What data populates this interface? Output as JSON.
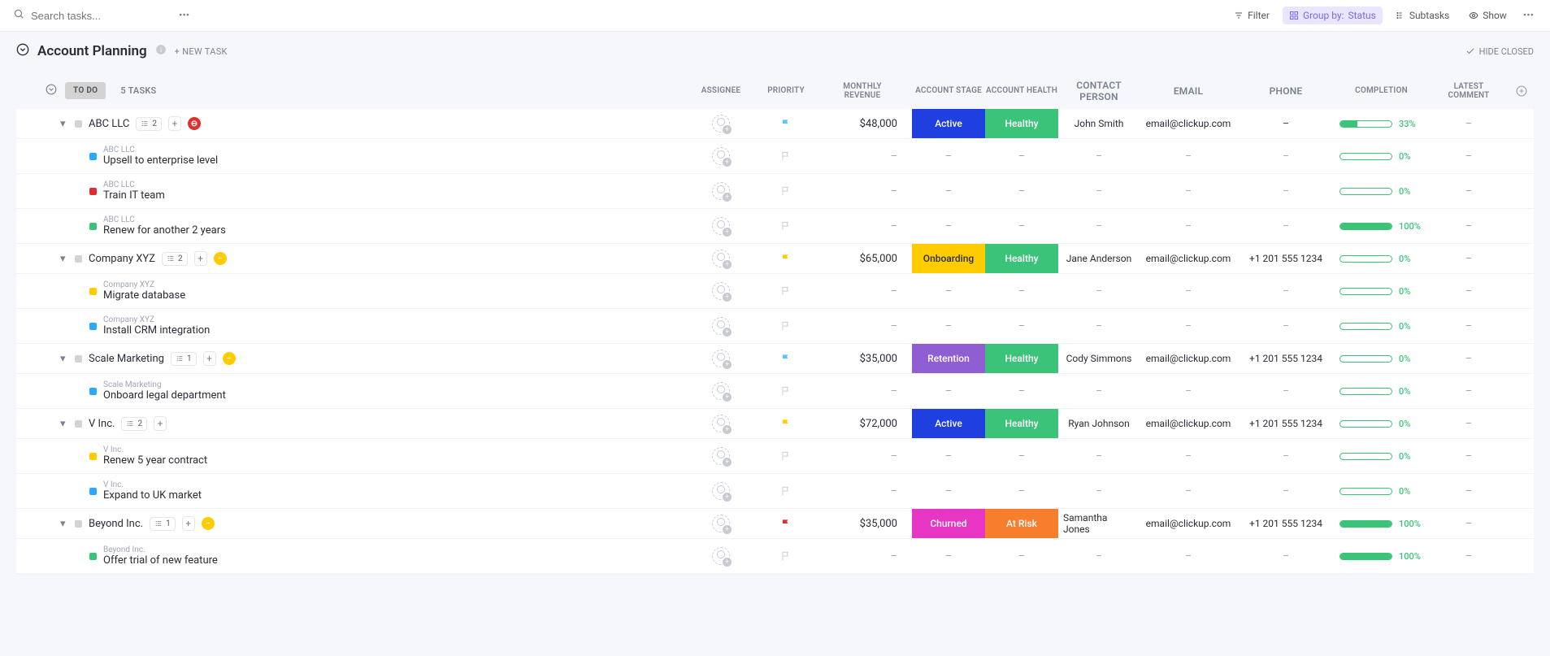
{
  "topbar": {
    "search_placeholder": "Search tasks...",
    "filter": "Filter",
    "group_by_prefix": "Group by:",
    "group_by_value": "Status",
    "subtasks": "Subtasks",
    "show": "Show"
  },
  "list": {
    "title": "Account Planning",
    "new_task": "+ NEW TASK",
    "hide_closed": "HIDE CLOSED"
  },
  "columns": {
    "assignee": "ASSIGNEE",
    "priority": "PRIORITY",
    "revenue": "MONTHLY REVENUE",
    "stage": "ACCOUNT STAGE",
    "health": "ACCOUNT HEALTH",
    "contact": "CONTACT PERSON",
    "email": "EMAIL",
    "phone": "PHONE",
    "completion": "COMPLETION",
    "comment": "LATEST COMMENT"
  },
  "group": {
    "status": "TO DO",
    "count": "5 TASKS"
  },
  "tasks": [
    {
      "name": "ABC LLC",
      "subtask_count": "2",
      "status_dot": "red",
      "priority": "blue",
      "revenue": "$48,000",
      "stage": "Active",
      "stage_bg": "bg-active",
      "health": "Healthy",
      "health_bg": "bg-healthy",
      "contact": "John Smith",
      "email": "email@clickup.com",
      "phone": "–",
      "completion_pct": 33,
      "completion_label": "33%",
      "subtasks": [
        {
          "sq": "blue",
          "parent": "ABC LLC",
          "name": "Upsell to enterprise level",
          "completion_pct": 0,
          "completion_label": "0%"
        },
        {
          "sq": "red",
          "parent": "ABC LLC",
          "name": "Train IT team",
          "completion_pct": 0,
          "completion_label": "0%"
        },
        {
          "sq": "green",
          "parent": "ABC LLC",
          "name": "Renew for another 2 years",
          "completion_pct": 100,
          "completion_label": "100%"
        }
      ]
    },
    {
      "name": "Company XYZ",
      "subtask_count": "2",
      "status_dot": "yellow",
      "priority": "yellow",
      "revenue": "$65,000",
      "stage": "Onboarding",
      "stage_bg": "bg-onboarding",
      "health": "Healthy",
      "health_bg": "bg-healthy",
      "contact": "Jane Anderson",
      "email": "email@clickup.com",
      "phone": "+1 201 555 1234",
      "completion_pct": 0,
      "completion_label": "0%",
      "subtasks": [
        {
          "sq": "yellow",
          "parent": "Company XYZ",
          "name": "Migrate database",
          "completion_pct": 0,
          "completion_label": "0%"
        },
        {
          "sq": "blue",
          "parent": "Company XYZ",
          "name": "Install CRM integration",
          "completion_pct": 0,
          "completion_label": "0%"
        }
      ]
    },
    {
      "name": "Scale Marketing",
      "subtask_count": "1",
      "status_dot": "yellow",
      "priority": "blue",
      "revenue": "$35,000",
      "stage": "Retention",
      "stage_bg": "bg-retention",
      "health": "Healthy",
      "health_bg": "bg-healthy",
      "contact": "Cody Simmons",
      "email": "email@clickup.com",
      "phone": "+1 201 555 1234",
      "completion_pct": 0,
      "completion_label": "0%",
      "subtasks": [
        {
          "sq": "blue",
          "parent": "Scale Marketing",
          "name": "Onboard legal department",
          "completion_pct": 0,
          "completion_label": "0%"
        }
      ]
    },
    {
      "name": "V Inc.",
      "subtask_count": "2",
      "status_dot": "",
      "priority": "yellow",
      "revenue": "$72,000",
      "stage": "Active",
      "stage_bg": "bg-active",
      "health": "Healthy",
      "health_bg": "bg-healthy",
      "contact": "Ryan Johnson",
      "email": "email@clickup.com",
      "phone": "+1 201 555 1234",
      "completion_pct": 0,
      "completion_label": "0%",
      "subtasks": [
        {
          "sq": "yellow",
          "parent": "V Inc.",
          "name": "Renew 5 year contract",
          "completion_pct": 0,
          "completion_label": "0%"
        },
        {
          "sq": "blue",
          "parent": "V Inc.",
          "name": "Expand to UK market",
          "completion_pct": 0,
          "completion_label": "0%"
        }
      ]
    },
    {
      "name": "Beyond Inc.",
      "subtask_count": "1",
      "status_dot": "yellow",
      "priority": "red",
      "revenue": "$35,000",
      "stage": "Churned",
      "stage_bg": "bg-churned",
      "health": "At Risk",
      "health_bg": "bg-atrisk",
      "contact": "Samantha Jones",
      "email": "email@clickup.com",
      "phone": "+1 201 555 1234",
      "completion_pct": 100,
      "completion_label": "100%",
      "subtasks": [
        {
          "sq": "green",
          "parent": "Beyond Inc.",
          "name": "Offer trial of new feature",
          "completion_pct": 100,
          "completion_label": "100%"
        }
      ]
    }
  ]
}
